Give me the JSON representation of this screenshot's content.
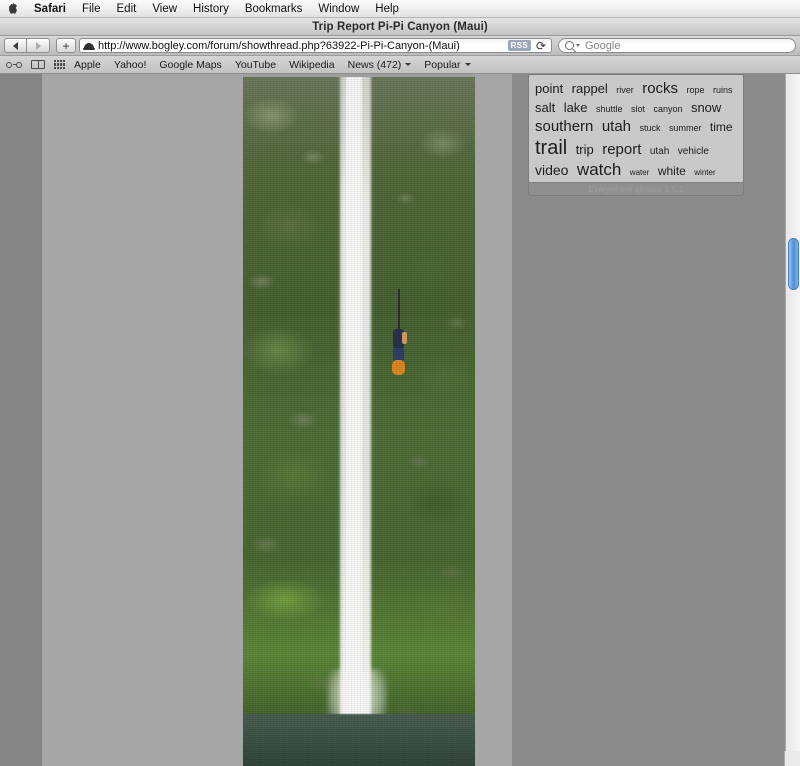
{
  "menubar": {
    "apple_icon": "apple-logo-icon",
    "items": [
      {
        "label": "Safari",
        "bold": true
      },
      {
        "label": "File"
      },
      {
        "label": "Edit"
      },
      {
        "label": "View"
      },
      {
        "label": "History"
      },
      {
        "label": "Bookmarks"
      },
      {
        "label": "Window"
      },
      {
        "label": "Help"
      }
    ]
  },
  "window": {
    "title": "Trip Report Pi-Pi Canyon (Maui)"
  },
  "toolbar": {
    "back_icon": "back-arrow-icon",
    "forward_icon": "forward-arrow-icon",
    "add_bookmark_label": "+",
    "favicon": "site-favicon",
    "url": "http://www.bogley.com/forum/showthread.php?63922-Pi-Pi-Canyon-(Maui)",
    "rss_label": "RSS",
    "reload_icon": "reload-icon",
    "search_placeholder": "Google",
    "search_value": ""
  },
  "bookmarks_bar": {
    "icons": [
      {
        "name": "reader-glasses-icon"
      },
      {
        "name": "bookmarks-book-icon"
      },
      {
        "name": "top-sites-grid-icon"
      }
    ],
    "links": [
      {
        "label": "Apple",
        "menu": false
      },
      {
        "label": "Yahoo!",
        "menu": false
      },
      {
        "label": "Google Maps",
        "menu": false
      },
      {
        "label": "YouTube",
        "menu": false
      },
      {
        "label": "Wikipedia",
        "menu": false
      },
      {
        "label": "News (472)",
        "menu": true
      },
      {
        "label": "Popular",
        "menu": true
      }
    ]
  },
  "content": {
    "photo_alt": "waterfall-canyoneering-photo"
  },
  "tag_cloud": {
    "footer": "Everywhere glossar 1.5.1",
    "tags": [
      {
        "label": "point",
        "size": 13
      },
      {
        "label": "rappel",
        "size": 13
      },
      {
        "label": "river",
        "size": 9
      },
      {
        "label": "rocks",
        "size": 15
      },
      {
        "label": "rope",
        "size": 9
      },
      {
        "label": "ruins",
        "size": 9
      },
      {
        "label": "salt",
        "size": 13
      },
      {
        "label": "lake",
        "size": 13
      },
      {
        "label": "shuttle",
        "size": 9
      },
      {
        "label": "slot",
        "size": 9
      },
      {
        "label": "canyon",
        "size": 9
      },
      {
        "label": "snow",
        "size": 13
      },
      {
        "label": "southern",
        "size": 15
      },
      {
        "label": "utah",
        "size": 15
      },
      {
        "label": "stuck",
        "size": 9
      },
      {
        "label": "summer",
        "size": 9
      },
      {
        "label": "time",
        "size": 12
      },
      {
        "label": "trail",
        "size": 20
      },
      {
        "label": "trip",
        "size": 13
      },
      {
        "label": "report",
        "size": 15
      },
      {
        "label": "utah",
        "size": 10
      },
      {
        "label": "vehicle",
        "size": 10
      },
      {
        "label": "video",
        "size": 14
      },
      {
        "label": "watch",
        "size": 17
      },
      {
        "label": "water",
        "size": 8
      },
      {
        "label": "white",
        "size": 12
      },
      {
        "label": "winter",
        "size": 8
      }
    ]
  },
  "scrollbar": {
    "vertical_thumb_name": "vertical-scrollbar-thumb"
  }
}
